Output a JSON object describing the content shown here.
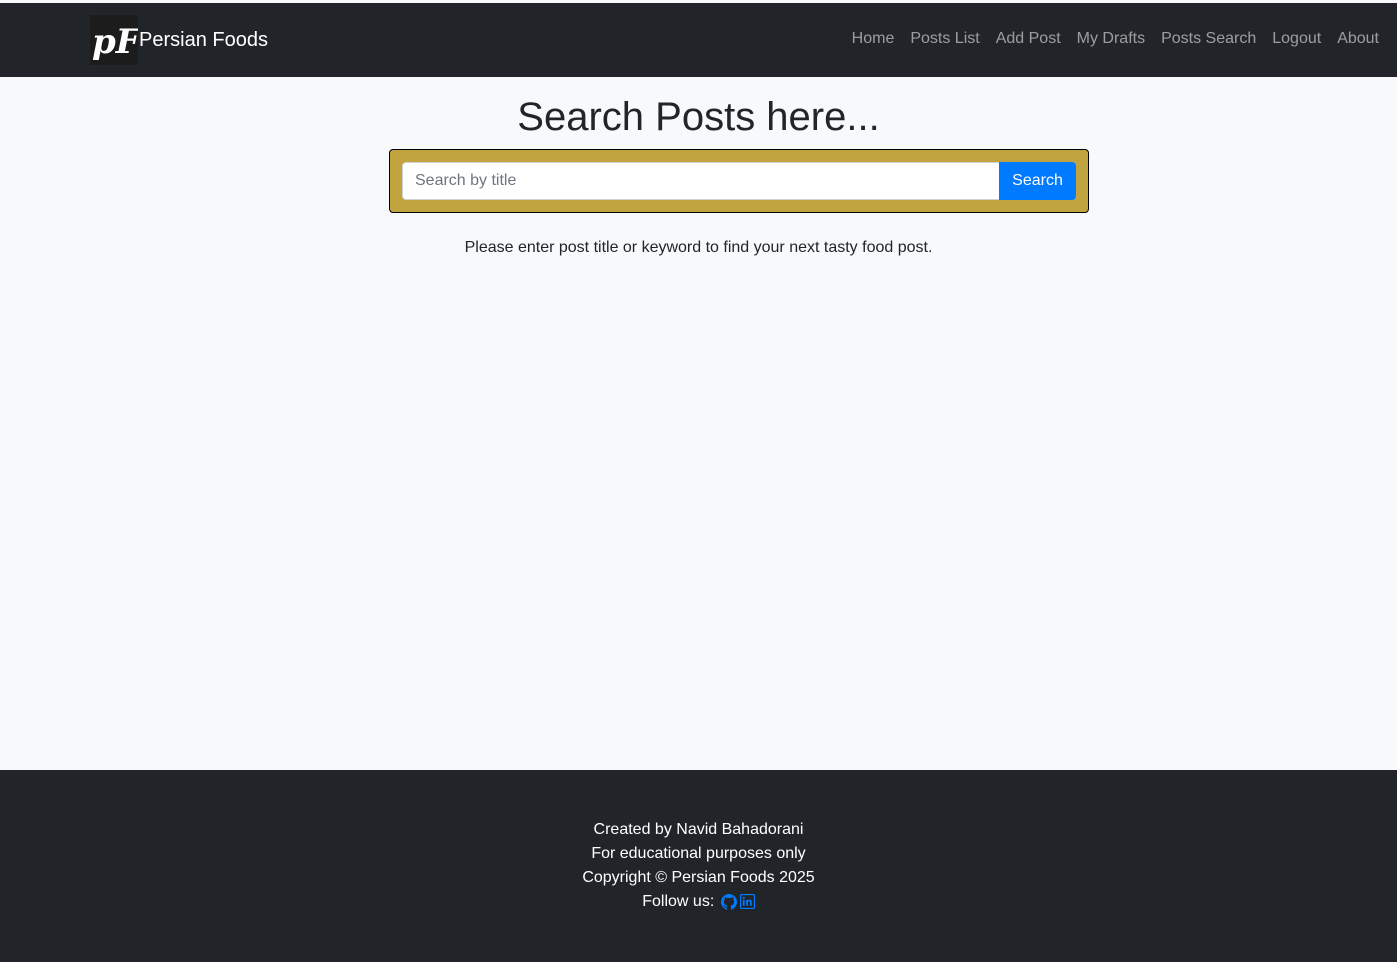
{
  "brand": {
    "logo_text": "pF",
    "name": "Persian Foods"
  },
  "nav": {
    "items": [
      {
        "label": "Home"
      },
      {
        "label": "Posts List"
      },
      {
        "label": "Add Post"
      },
      {
        "label": "My Drafts"
      },
      {
        "label": "Posts Search"
      },
      {
        "label": "Logout"
      },
      {
        "label": "About"
      }
    ]
  },
  "main": {
    "title": "Search Posts here...",
    "search": {
      "placeholder": "Search by title",
      "value": "",
      "button_label": "Search"
    },
    "hint": "Please enter post title or keyword to find your next tasty food post."
  },
  "footer": {
    "created_by": "Created by Navid Bahadorani",
    "purpose": "For educational purposes only",
    "copyright": "Copyright © Persian Foods 2025",
    "follow_label": "Follow us:",
    "social_icons": [
      "github-icon",
      "linkedin-icon"
    ]
  },
  "colors": {
    "navbar_bg": "#212529",
    "search_panel_bg": "#c1a43f",
    "primary": "#007bff",
    "page_bg": "#f8f9fa"
  }
}
